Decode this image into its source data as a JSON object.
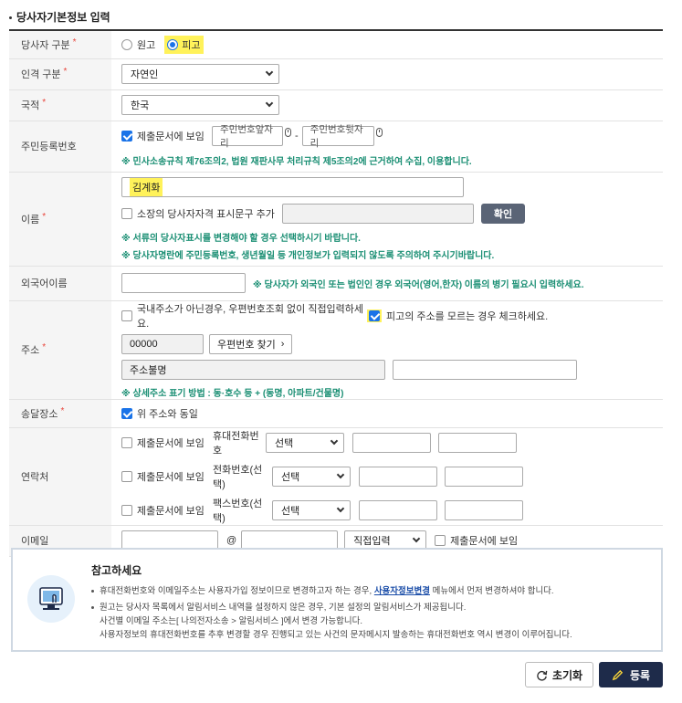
{
  "section": {
    "title": "당사자기본정보 입력"
  },
  "fields": {
    "party_type": {
      "label": "당사자 구분",
      "options": [
        "원고",
        "피고"
      ],
      "selected": "피고"
    },
    "person_type": {
      "label": "인격 구분",
      "value": "자연인"
    },
    "nationality": {
      "label": "국적",
      "value": "한국"
    },
    "rrn": {
      "label": "주민등록번호",
      "submit_label": "제출문서에 보임",
      "front_placeholder": "주민번호앞자리",
      "back_placeholder": "주민번호뒷자리",
      "dash": "-",
      "notice": "※ 민사소송규칙 제76조의2, 법원 재판사무 처리규칙 제5조의2에 근거하여 수집, 이용합니다."
    },
    "name": {
      "label": "이름",
      "value": "김계화",
      "add_label": "소장의 당사자자격 표시문구 추가",
      "confirm_button": "확인",
      "notice1": "※ 서류의 당사자표시를 변경해야 할 경우 선택하시기 바랍니다.",
      "notice2": "※ 당사자명란에 주민등록번호, 생년월일 등 개인정보가 입력되지 않도록 주의하여 주시기바랍니다."
    },
    "foreign_name": {
      "label": "외국어이름",
      "notice": "※ 당사자가 외국인 또는 법인인 경우 외국어(영어,한자) 이름의 병기 필요시 입력하세요."
    },
    "address": {
      "label": "주소",
      "manual_label": "국내주소가 아닌경우, 우편번호조회 없이 직접입력하세요.",
      "unknown_label": "피고의 주소를 모르는 경우 체크하세요.",
      "postcode": "00000",
      "postcode_button": "우편번호 찾기",
      "address_value": "주소불명",
      "notice": "※ 상세주소 표기 방법 : 동·호수 등 + (동명, 아파트/건물명)"
    },
    "delivery": {
      "label": "송달장소",
      "same_label": "위 주소와 동일"
    },
    "contact": {
      "label": "연락처",
      "submit_label": "제출문서에 보임",
      "rows": [
        {
          "type_label": "휴대전화번호",
          "select_value": "선택"
        },
        {
          "type_label": "전화번호(선택)",
          "select_value": "선택"
        },
        {
          "type_label": "팩스번호(선택)",
          "select_value": "선택"
        }
      ]
    },
    "email": {
      "label": "이메일",
      "at": "@",
      "domain_select": "직접입력",
      "submit_label": "제출문서에 보임"
    }
  },
  "reference": {
    "title": "참고하세요",
    "line1_a": "휴대전화번호와 이메일주소는 사용자가입 정보이므로 변경하고자 하는 경우,",
    "line1_link": "사용자정보변경",
    "line1_b": "메뉴에서 먼저 변경하셔야 합니다.",
    "line2": "원고는 당사자 목록에서 알림서비스 내역을 설정하지 않은 경우, 기본 설정의 알림서비스가 제공됩니다.",
    "line3": "사건별 이메일 주소는[ 나의전자소송 > 알림서비스 ]에서 변경 가능합니다.",
    "line4": "사용자정보의 휴대전화번호를 추후 변경할 경우 진행되고 있는 사건의 문자메시지 발송하는 휴대전화번호 역시 변경이 이루어집니다."
  },
  "actions": {
    "reset": "초기화",
    "submit": "등록"
  },
  "colors": {
    "accent": "#1a73e8",
    "notice": "#1b8f74",
    "highlight": "#fff25a",
    "submit_bg": "#1e2b4a",
    "required": "#e8453c"
  }
}
